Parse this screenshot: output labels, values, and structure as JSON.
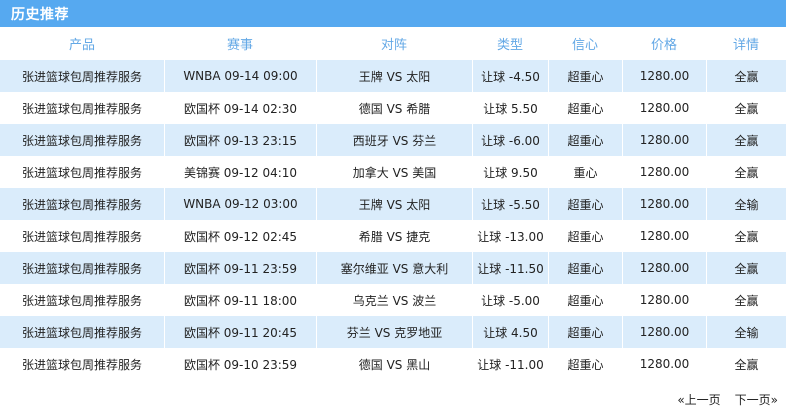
{
  "header": {
    "title": "历史推荐"
  },
  "columns": [
    "产品",
    "赛事",
    "对阵",
    "类型",
    "信心",
    "价格",
    "详情"
  ],
  "rows": [
    {
      "product": "张进篮球包周推荐服务",
      "match": "WNBA 09-14 09:00",
      "vs": "王牌 VS 太阳",
      "type": "让球 -4.50",
      "confidence": "超重心",
      "price": "1280.00",
      "detail": "全赢"
    },
    {
      "product": "张进篮球包周推荐服务",
      "match": "欧国杯 09-14 02:30",
      "vs": "德国 VS 希腊",
      "type": "让球 5.50",
      "confidence": "超重心",
      "price": "1280.00",
      "detail": "全赢"
    },
    {
      "product": "张进篮球包周推荐服务",
      "match": "欧国杯 09-13 23:15",
      "vs": "西班牙 VS 芬兰",
      "type": "让球 -6.00",
      "confidence": "超重心",
      "price": "1280.00",
      "detail": "全赢"
    },
    {
      "product": "张进篮球包周推荐服务",
      "match": "美锦赛 09-12 04:10",
      "vs": "加拿大 VS 美国",
      "type": "让球 9.50",
      "confidence": "重心",
      "price": "1280.00",
      "detail": "全赢"
    },
    {
      "product": "张进篮球包周推荐服务",
      "match": "WNBA 09-12 03:00",
      "vs": "王牌 VS 太阳",
      "type": "让球 -5.50",
      "confidence": "超重心",
      "price": "1280.00",
      "detail": "全输"
    },
    {
      "product": "张进篮球包周推荐服务",
      "match": "欧国杯 09-12 02:45",
      "vs": "希腊 VS 捷克",
      "type": "让球 -13.00",
      "confidence": "超重心",
      "price": "1280.00",
      "detail": "全赢"
    },
    {
      "product": "张进篮球包周推荐服务",
      "match": "欧国杯 09-11 23:59",
      "vs": "塞尔维亚 VS 意大利",
      "type": "让球 -11.50",
      "confidence": "超重心",
      "price": "1280.00",
      "detail": "全赢"
    },
    {
      "product": "张进篮球包周推荐服务",
      "match": "欧国杯 09-11 18:00",
      "vs": "乌克兰 VS 波兰",
      "type": "让球 -5.00",
      "confidence": "超重心",
      "price": "1280.00",
      "detail": "全赢"
    },
    {
      "product": "张进篮球包周推荐服务",
      "match": "欧国杯 09-11 20:45",
      "vs": "芬兰 VS 克罗地亚",
      "type": "让球 4.50",
      "confidence": "超重心",
      "price": "1280.00",
      "detail": "全输"
    },
    {
      "product": "张进篮球包周推荐服务",
      "match": "欧国杯 09-10 23:59",
      "vs": "德国 VS 黑山",
      "type": "让球 -11.00",
      "confidence": "超重心",
      "price": "1280.00",
      "detail": "全赢"
    }
  ],
  "pager": {
    "prev": "«上一页",
    "next": "下一页»"
  },
  "colors": {
    "header_bg": "#56a9f0",
    "header_text": "#ffffff",
    "column_header_text": "#63a8e6",
    "alt_row_bg": "#daecfb"
  }
}
